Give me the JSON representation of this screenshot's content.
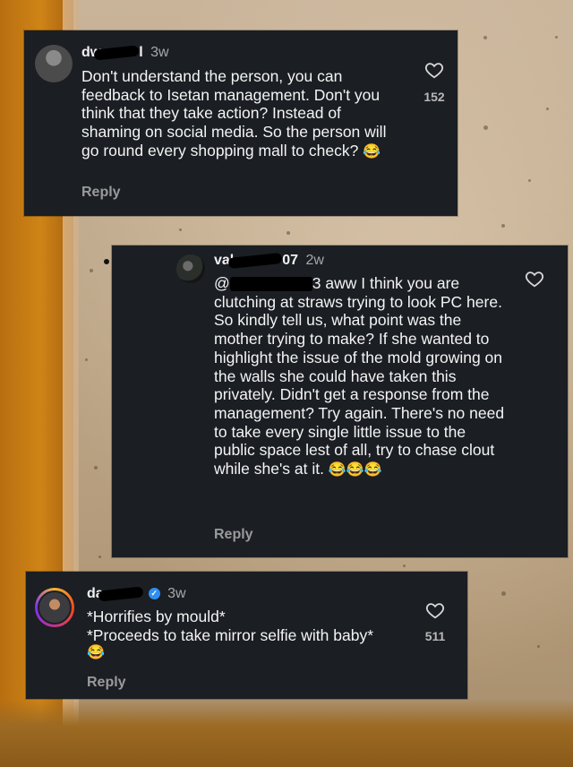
{
  "comments": [
    {
      "username_visible": "dw",
      "username_tail": "l",
      "time": "3w",
      "text": "Don't understand the person, you can feedback to Isetan management. Don't you think that they take action? Instead of shaming on social media. So the person will go round every shopping mall to check?",
      "emoji": "😂",
      "likes": "152",
      "reply_label": "Reply"
    },
    {
      "username_visible": "val",
      "username_tail": "07",
      "time": "2w",
      "mention_prefix": "@",
      "mention_tail": "3",
      "text": "aww I think you are clutching at straws trying to look PC here. So kindly tell us, what point was the mother trying to make? If she wanted to highlight the issue of the mold growing on the walls she could have taken this privately. Didn't get a response from the management? Try again. There's no need to take every single little issue to the public space lest of all, try to chase clout while she's at it.",
      "emoji": "😂😂😂",
      "reply_label": "Reply"
    },
    {
      "username_visible": "da",
      "time": "3w",
      "verified": true,
      "line1": "*Horrifies by mould*",
      "line2": "*Proceeds to take mirror selfie with baby*",
      "emoji": "😂",
      "likes": "511",
      "reply_label": "Reply"
    }
  ],
  "colors": {
    "card_bg": "#1b1e23",
    "text": "#f4f4f4",
    "muted": "#9a9a9a",
    "verified": "#2f8ff0",
    "wall_orange": "#cf8416"
  },
  "icons": [
    "heart-outline-icon",
    "verified-badge-icon"
  ]
}
